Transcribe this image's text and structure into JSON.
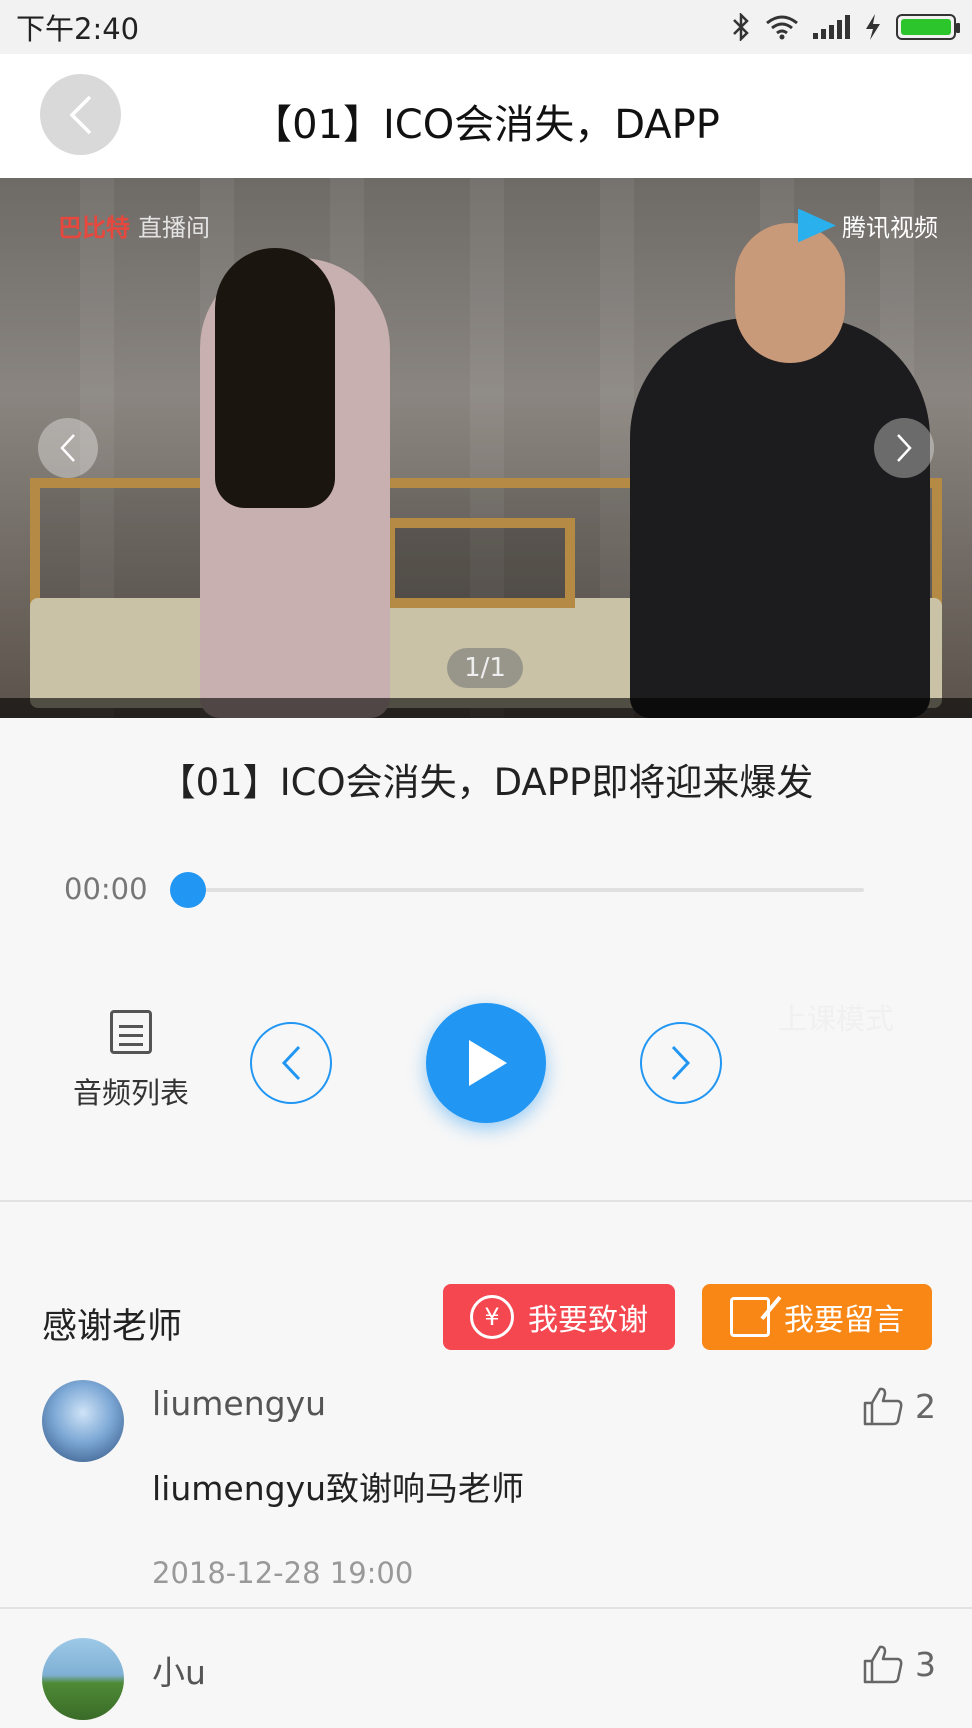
{
  "status_bar": {
    "time": "下午2:40",
    "battery_color": "#2cc52c"
  },
  "header": {
    "title": "【01】ICO会消失，DAPP"
  },
  "media": {
    "logo_left_brand": "巴比特",
    "logo_left_suffix": "直播间",
    "logo_right": "腾讯视频",
    "page_indicator": "1/1"
  },
  "audio": {
    "title": "【01】ICO会消失，DAPP即将迎来爆发",
    "current_time": "00:00",
    "progress": 0
  },
  "controls": {
    "playlist_label": "音频列表",
    "class_mode_label": "上课模式",
    "accent_color": "#2196f3"
  },
  "thanks": {
    "section_title": "感谢老师",
    "thank_button": "我要致谢",
    "comment_button": "我要留言",
    "thank_color": "#f4474f",
    "comment_color": "#f98716"
  },
  "comments": [
    {
      "username": "liumengyu",
      "text": "liumengyu致谢响马老师",
      "time": "2018-12-28  19:00",
      "likes": "2"
    },
    {
      "username": "小u",
      "likes": "3"
    }
  ]
}
